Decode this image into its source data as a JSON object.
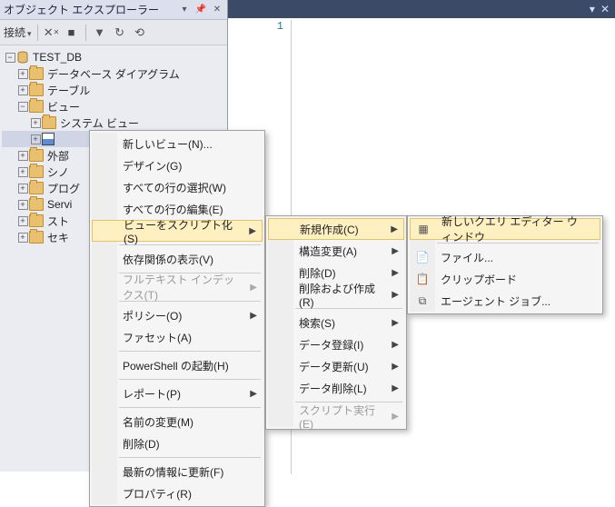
{
  "panel": {
    "title": "オブジェクト エクスプローラー",
    "toolbar_connect": "接続"
  },
  "tree": {
    "db": "TEST_DB",
    "diagrams": "データベース ダイアグラム",
    "tables": "テーブル",
    "views": "ビュー",
    "system_views": "システム ビュー",
    "ext": "外部",
    "syn": "シノ",
    "prog": "プログ",
    "servi": "Servi",
    "stor": "スト",
    "sec": "セキ"
  },
  "menu1": {
    "new_view": "新しいビュー(N)...",
    "design": "デザイン(G)",
    "select_all": "すべての行の選択(W)",
    "edit_all": "すべての行の編集(E)",
    "script": "ビューをスクリプト化(S)",
    "deps": "依存関係の表示(V)",
    "fulltext": "フルテキスト インデックス(T)",
    "policy": "ポリシー(O)",
    "facet": "ファセット(A)",
    "powershell": "PowerShell の起動(H)",
    "report": "レポート(P)",
    "rename": "名前の変更(M)",
    "delete": "削除(D)",
    "refresh": "最新の情報に更新(F)",
    "properties": "プロパティ(R)"
  },
  "menu2": {
    "create": "新規作成(C)",
    "alter": "構造変更(A)",
    "drop": "削除(D)",
    "drop_create": "削除および作成(R)",
    "select": "検索(S)",
    "insert": "データ登録(I)",
    "update": "データ更新(U)",
    "delete": "データ削除(L)",
    "execute": "スクリプト実行(E)"
  },
  "menu3": {
    "query_window": "新しいクエリ エディター ウィンドウ",
    "file": "ファイル...",
    "clipboard": "クリップボード",
    "agent": "エージェント ジョブ..."
  },
  "editor": {
    "line_no": "1"
  }
}
